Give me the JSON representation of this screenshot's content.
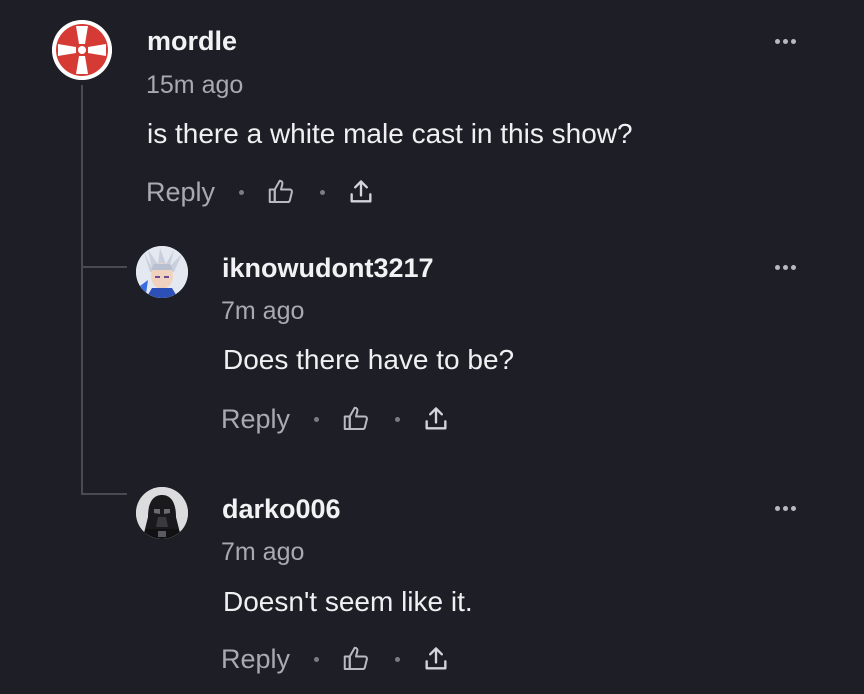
{
  "comments": [
    {
      "username": "mordle",
      "time": "15m ago",
      "text": "is there a white male cast in this show?",
      "reply_label": "Reply",
      "avatar_icon": "ign-logo-icon"
    },
    {
      "username": "iknowudont3217",
      "time": "7m ago",
      "text": "Does there have to be?",
      "reply_label": "Reply",
      "avatar_icon": "anime-character-avatar"
    },
    {
      "username": "darko006",
      "time": "7m ago",
      "text": "Doesn't seem like it.",
      "reply_label": "Reply",
      "avatar_icon": "darth-vader-avatar"
    }
  ],
  "icons": {
    "like": "thumbs-up-icon",
    "share": "share-icon",
    "more": "more-options-icon"
  },
  "colors": {
    "background": "#1e1f26",
    "text": "#f0f0f2",
    "muted": "#a9aab0",
    "thread_line": "#4a4b52",
    "ign_red": "#d63a34"
  }
}
